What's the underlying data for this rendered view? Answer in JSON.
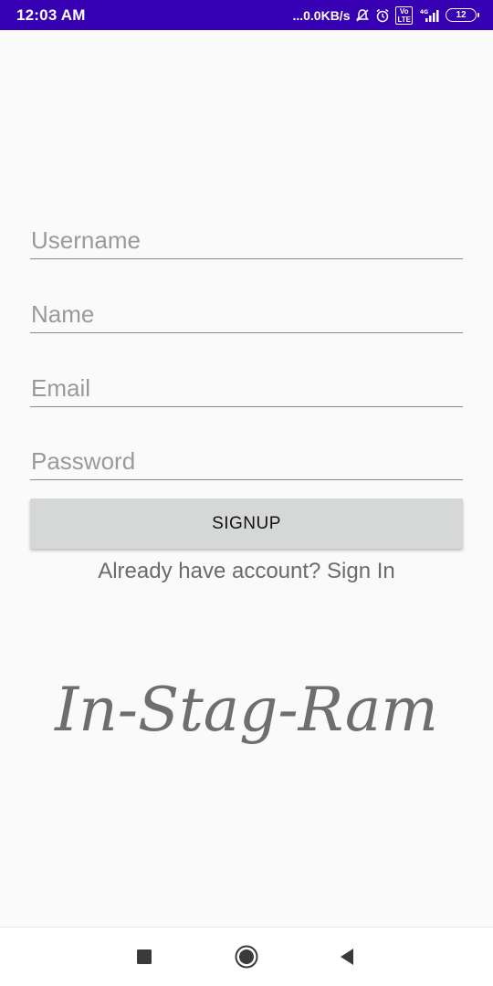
{
  "status_bar": {
    "time": "12:03 AM",
    "network_speed": "...0.0KB/s",
    "network_type": "4G",
    "volte": "Vo LTE",
    "battery": "12"
  },
  "form": {
    "username_placeholder": "Username",
    "name_placeholder": "Name",
    "email_placeholder": "Email",
    "password_placeholder": "Password",
    "signup_label": "SIGNUP",
    "signin_text": "Already have account? Sign In"
  },
  "logo": {
    "text": "In-Stag-Ram"
  },
  "colors": {
    "status_bar": "#3700b3",
    "background": "#fafafa",
    "button": "#d6d7d7",
    "hint": "#9a9a9a",
    "link_text": "#6b6b6b",
    "logo": "#6e6e6e"
  },
  "nav_bar": {
    "icons": [
      "recent-apps-icon",
      "home-icon",
      "back-icon"
    ]
  }
}
